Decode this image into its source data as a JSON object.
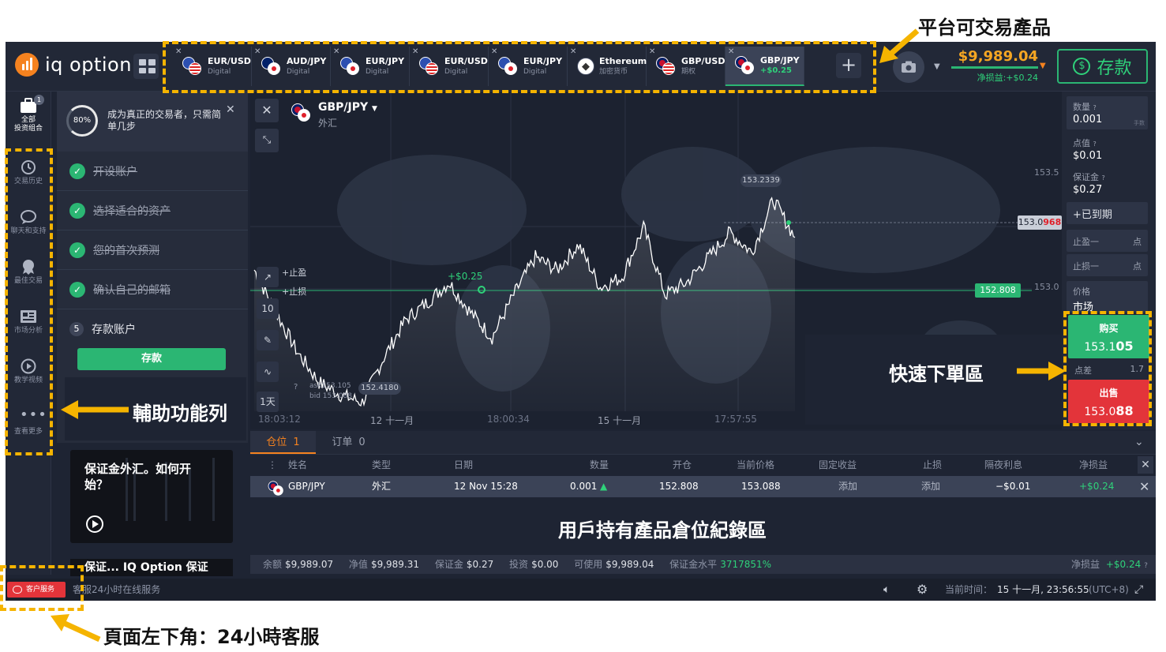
{
  "header": {
    "logo_text": "iq option",
    "tabs": [
      {
        "name": "EUR/USD",
        "sub": "Digital",
        "flag": "eur-usd"
      },
      {
        "name": "AUD/JPY",
        "sub": "Digital",
        "flag": "aud-jpy"
      },
      {
        "name": "EUR/JPY",
        "sub": "Digital",
        "flag": "eur-jpy"
      },
      {
        "name": "EUR/USD",
        "sub": "Digital",
        "flag": "eur-usd"
      },
      {
        "name": "EUR/JPY",
        "sub": "Digital",
        "flag": "eur-jpy"
      },
      {
        "name": "Ethereum",
        "sub": "加密货币",
        "flag": "ethereum"
      },
      {
        "name": "GBP/USD",
        "sub": "期权",
        "flag": "gbp-usd-otc"
      },
      {
        "name": "GBP/JPY",
        "sub": "+$0.25",
        "flag": "gbp-jpy"
      }
    ],
    "balance": "$9,989.04",
    "pnl": "净损益:+$0.24",
    "deposit_label": "存款"
  },
  "rail": {
    "items": [
      {
        "label": "全部\n投资组合",
        "icon": "briefcase-icon",
        "badge": "1"
      },
      {
        "label": "交易历史",
        "icon": "history-icon"
      },
      {
        "label": "聊天和支持",
        "icon": "chat-icon"
      },
      {
        "label": "最佳交易",
        "icon": "trophy-icon"
      },
      {
        "label": "市场分析",
        "icon": "newspaper-icon"
      },
      {
        "label": "教学视频",
        "icon": "play-icon"
      },
      {
        "label": "查看更多",
        "icon": "more-icon"
      }
    ]
  },
  "onboarding": {
    "progress": "80%",
    "text": "成为真正的交易者，只需简单几步",
    "steps": [
      {
        "label": "开设账户",
        "done": true
      },
      {
        "label": "选择适合的资产",
        "done": true
      },
      {
        "label": "您的首次预测",
        "done": true
      },
      {
        "label": "确认自己的邮箱",
        "done": true
      },
      {
        "label": "存款账户",
        "num": "5"
      }
    ],
    "deposit_button": "存款"
  },
  "videos": [
    {
      "title": "保证金外汇。如何开始？"
    },
    {
      "title": "保证... IQ Option 保证"
    }
  ],
  "chart": {
    "asset": "GBP/JPY",
    "asset_type": "外汇",
    "y_labels": [
      "153.5",
      "153.0"
    ],
    "current_price_prefix": "153.0",
    "current_price_hl": "968",
    "open_price": "152.808",
    "peak_label": "153.2339",
    "trade_pl": "+$0.25",
    "take_profit": "止盈",
    "stop_loss": "止损",
    "ask": "ask153.105",
    "bid": "bid 153.088",
    "last_low": "152.4180",
    "timeframe": "1天",
    "x_labels": [
      "18:03:12",
      "12 十一月",
      "18:00:34",
      "15 十一月",
      "17:57:55"
    ]
  },
  "chart_data": {
    "type": "line",
    "title": "GBP/JPY",
    "x": [
      "18:03:12",
      "12 十一月",
      "18:00:34",
      "15 十一月",
      "17:57:55"
    ],
    "ylim": [
      152.4,
      153.6
    ],
    "series": [
      {
        "name": "GBP/JPY",
        "values": [
          152.95,
          152.78,
          152.62,
          152.5,
          152.45,
          152.42,
          152.6,
          152.75,
          152.82,
          152.9,
          152.78,
          152.68,
          152.85,
          153.0,
          152.95,
          153.05,
          152.88,
          152.92,
          153.12,
          152.85,
          152.9,
          153.0,
          153.1,
          153.02,
          153.23,
          153.08
        ]
      }
    ],
    "annotations": [
      "153.2339",
      "152.808",
      "153.0968",
      "152.4180"
    ]
  },
  "right_panel": {
    "quantity_label": "数量",
    "quantity": "0.001",
    "quantity_unit": "手数",
    "pip_label": "点值",
    "pip_value": "$0.01",
    "margin_label": "保证金",
    "margin_value": "$0.27",
    "expiry": "+已到期",
    "tp_label": "止盈一",
    "tp_unit": "点",
    "sl_label": "止损一",
    "sl_unit": "点",
    "price_label": "价格",
    "price_value": "市场",
    "buy_label": "购买",
    "buy_price_a": "153.1",
    "buy_price_b": "05",
    "spread_label": "点差",
    "spread_value": "1.7",
    "sell_label": "出售",
    "sell_price_a": "153.0",
    "sell_price_b": "88"
  },
  "positions": {
    "tab_positions": "仓位",
    "tab_positions_count": "1",
    "tab_orders": "订单",
    "tab_orders_count": "0",
    "columns": [
      "姓名",
      "类型",
      "日期",
      "数量",
      "开仓",
      "当前价格",
      "固定收益",
      "止损",
      "隔夜利息",
      "净损益"
    ],
    "row": {
      "name": "GBP/JPY",
      "type": "外汇",
      "date": "12 Nov 15:28",
      "qty": "0.001",
      "open": "152.808",
      "current": "153.088",
      "fixed": "添加",
      "stop": "添加",
      "swap": "−$0.01",
      "pnl": "+$0.24"
    }
  },
  "summary": {
    "balance_label": "余额",
    "balance": "$9,989.07",
    "equity_label": "净值",
    "equity": "$9,989.31",
    "margin_label": "保证金",
    "margin": "$0.27",
    "invest_label": "投资",
    "invest": "$0.00",
    "avail_label": "可使用",
    "avail": "$9,989.04",
    "level_label": "保证金水平",
    "level": "3717851%",
    "pnl_label": "净损益",
    "pnl": "+$0.24"
  },
  "status": {
    "support_button": "客户服务",
    "support_text": "客服24小时在线服务",
    "time_label": "当前时间：",
    "time": "15 十一月, 23:56:55",
    "tz": "(UTC+8)"
  },
  "annotations": {
    "tabs_note": "平台可交易產品",
    "rail_note": "輔助功能列",
    "order_note": "快速下單區",
    "positions_note": "用戶持有產品倉位紀錄區",
    "support_note": "頁面左下角：24小時客服"
  },
  "colors": {
    "accent_green": "#2bb673",
    "sell_red": "#e3343a",
    "brand_orange": "#f5821f",
    "annotation_yellow": "#f5b400"
  }
}
